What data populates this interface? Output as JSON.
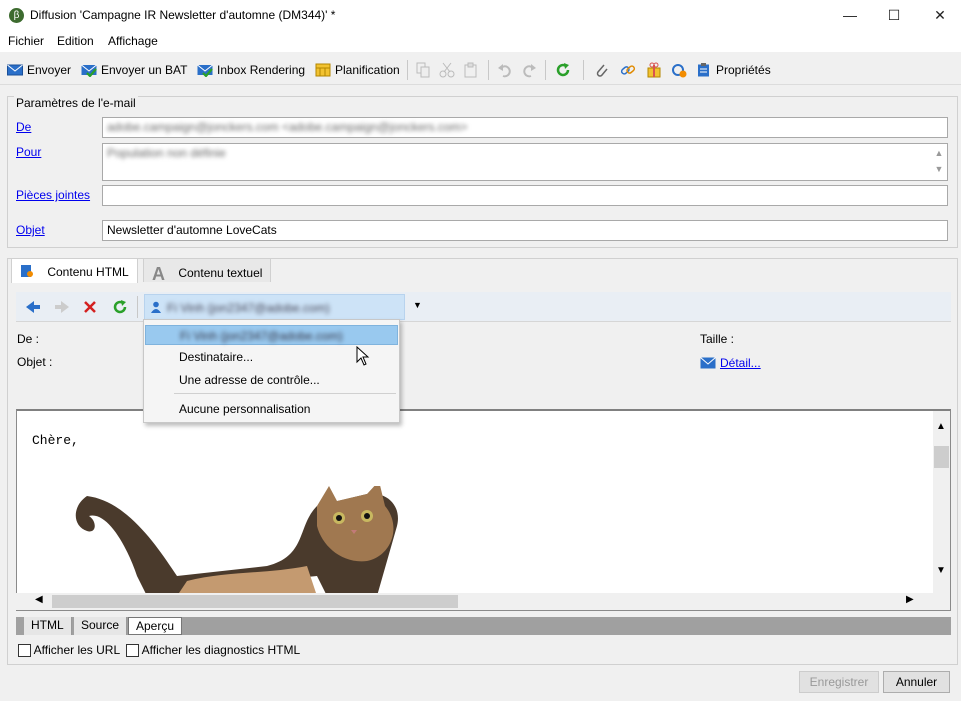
{
  "window": {
    "title": "Diffusion 'Campagne IR Newsletter d'automne (DM344)' *",
    "minimize": "—",
    "maximize": "☐",
    "close": "✕"
  },
  "menu": {
    "file": "Fichier",
    "edit": "Edition",
    "view": "Affichage"
  },
  "toolbar": {
    "send": "Envoyer",
    "send_proof": "Envoyer un BAT",
    "inbox_rendering": "Inbox Rendering",
    "planning": "Planification",
    "properties": "Propriétés"
  },
  "email_params": {
    "legend": "Paramètres de l'e-mail",
    "from_label": "De",
    "from_value": "adobe.campaign@jonckers.com <adobe.campaign@jonckers.com>",
    "to_label": "Pour",
    "to_value": "Population non définie",
    "attachments_label": "Pièces jointes",
    "attachments_value": "",
    "subject_label": "Objet",
    "subject_value": "Newsletter d'automne LoveCats"
  },
  "tabs": {
    "html": "Contenu HTML",
    "text": "Contenu textuel"
  },
  "preview_toolbar": {
    "recipient": "Fi Vinh (jon2347@adobe.com)"
  },
  "headers": {
    "from": "De :",
    "subject": "Objet :",
    "size": "Taille :",
    "detail": "Détail..."
  },
  "dropdown": {
    "items": [
      "Fi Vinh (jon2347@adobe.com)",
      "Destinataire...",
      "Une adresse de contrôle...",
      "Aucune personnalisation"
    ]
  },
  "preview": {
    "greeting": "Chère,"
  },
  "mode_tabs": {
    "html": "HTML",
    "source": "Source",
    "preview": "Aperçu"
  },
  "options": {
    "show_urls": "Afficher les URL",
    "show_diagnostics": "Afficher les diagnostics HTML"
  },
  "buttons": {
    "save": "Enregistrer",
    "cancel": "Annuler"
  },
  "colors": {
    "accent": "#1e5aa8",
    "link": "#0000ee",
    "dropdown_highlight": "#99c9ef"
  }
}
